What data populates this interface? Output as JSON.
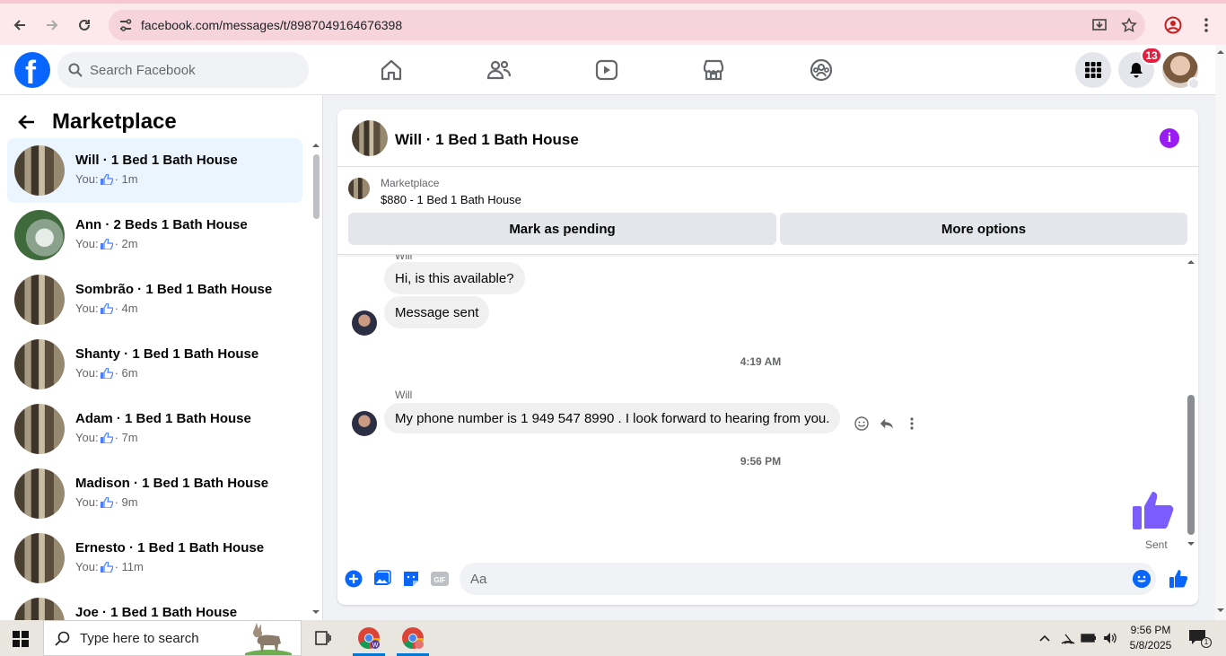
{
  "browser": {
    "url": "facebook.com/messages/t/8987049164676398"
  },
  "fb": {
    "logo": "f",
    "search_placeholder": "Search Facebook",
    "notifications_count": "13"
  },
  "left": {
    "title": "Marketplace",
    "conversations": [
      {
        "name": "Will · 1 Bed 1 Bath House",
        "prefix": "You:",
        "time": "· 1m"
      },
      {
        "name": "Ann · 2 Beds 1 Bath House",
        "prefix": "You:",
        "time": "· 2m"
      },
      {
        "name": "Sombrão · 1 Bed 1 Bath House",
        "prefix": "You:",
        "time": "· 4m"
      },
      {
        "name": "Shanty · 1 Bed 1 Bath House",
        "prefix": "You:",
        "time": "· 6m"
      },
      {
        "name": "Adam · 1 Bed 1 Bath House",
        "prefix": "You:",
        "time": "· 7m"
      },
      {
        "name": "Madison · 1 Bed 1 Bath House",
        "prefix": "You:",
        "time": "· 9m"
      },
      {
        "name": "Ernesto · 1 Bed 1 Bath House",
        "prefix": "You:",
        "time": "· 11m"
      },
      {
        "name": "Joe · 1 Bed 1 Bath House",
        "prefix": "You:",
        "time": ""
      }
    ]
  },
  "chat": {
    "title": "Will · 1 Bed 1 Bath House",
    "marketplace_label": "Marketplace",
    "listing": "$880 - 1 Bed 1 Bath House",
    "mark_pending": "Mark as pending",
    "more_options": "More options",
    "messages": {
      "top_sender": "Will",
      "m1": "Hi, is this available?",
      "m2": "Message sent",
      "time1": "4:19 AM",
      "sender2": "Will",
      "m3": "My phone number is 1 949 547 8990 .  I look forward to hearing from you.",
      "time2": "9:56 PM",
      "sent_label": "Sent"
    },
    "composer_placeholder": "Aa"
  },
  "taskbar": {
    "search_placeholder": "Type here to search",
    "time": "9:56 PM",
    "date": "5/8/2025",
    "notifications": "1"
  },
  "colors": {
    "fb_blue": "#0866ff",
    "like_purple": "#7b5cff",
    "info_purple": "#9b1bf3",
    "badge_red": "#e41e3f"
  }
}
